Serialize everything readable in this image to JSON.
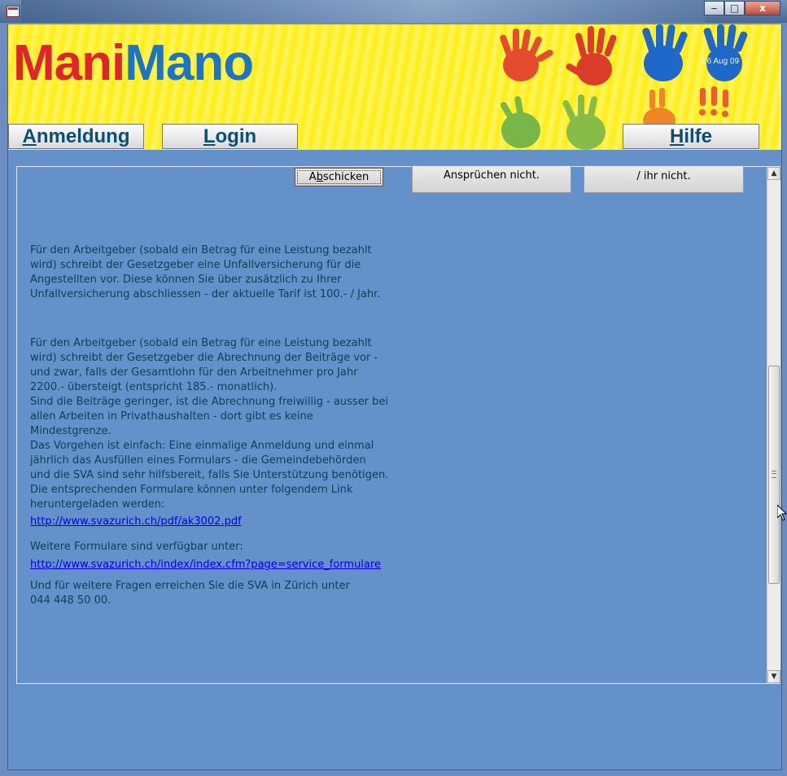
{
  "window": {
    "title": "",
    "controls": {
      "minimize": "‒",
      "maximize": "□",
      "close": "x"
    }
  },
  "header": {
    "logo_left": "Mani",
    "logo_right": "Mano",
    "version": "V.6 Aug 09",
    "colors": {
      "logo_left": "#e0242a",
      "logo_right": "#1b74c5",
      "background": "#ffee10"
    }
  },
  "nav": {
    "anmeldung": {
      "accel": "A",
      "rest": "nmeldung"
    },
    "login": {
      "accel": "L",
      "rest": "ogin"
    },
    "hilfe": {
      "accel": "H",
      "rest": "ilfe"
    }
  },
  "form": {
    "submit": {
      "pre": "A",
      "accel": "b",
      "post": "schicken"
    },
    "card1": "Ansprüchen nicht.",
    "card2": "/ ihr nicht."
  },
  "content": {
    "para1": [
      "Für den Arbeitgeber (sobald ein Betrag für eine Leistung bezahlt",
      "wird) schreibt der Gesetzgeber eine Unfallversicherung für die",
      "Angestellten vor. Diese können Sie über zusätzlich zu Ihrer",
      "Unfallversicherung abschliessen - der aktuelle Tarif ist 100.- / Jahr."
    ],
    "para2": [
      "Für den Arbeitgeber (sobald ein Betrag für eine Leistung bezahlt",
      "wird) schreibt der Gesetzgeber die Abrechnung der Beiträge vor -",
      "und zwar, falls der Gesamtlohn für den Arbeitnehmer pro Jahr",
      "2200.- übersteigt (entspricht 185.- monatlich).",
      "Sind die Beiträge geringer, ist die Abrechnung freiwillig - ausser bei",
      "allen Arbeiten in Privathaushalten - dort gibt es keine",
      "Mindestgrenze.",
      "Das Vorgehen ist einfach: Eine einmalige Anmeldung und einmal",
      "jährlich das Ausfüllen eines Formulars - die Gemeindebehörden",
      "und die SVA sind sehr hilfsbereit, falls Sie Unterstützung benötigen.",
      "Die entsprechenden Formulare können unter folgendem Link",
      "heruntergeladen werden:"
    ],
    "link1": "http://www.svazurich.ch/pdf/ak3002.pdf",
    "para3": "Weitere Formulare sind verfügbar unter:",
    "link2": "http://www.svazurich.ch/index/index.cfm?page=service_formulare",
    "para4": [
      "Und für weitere Fragen erreichen Sie die SVA in Zürich unter",
      "044 448 50 00."
    ]
  }
}
